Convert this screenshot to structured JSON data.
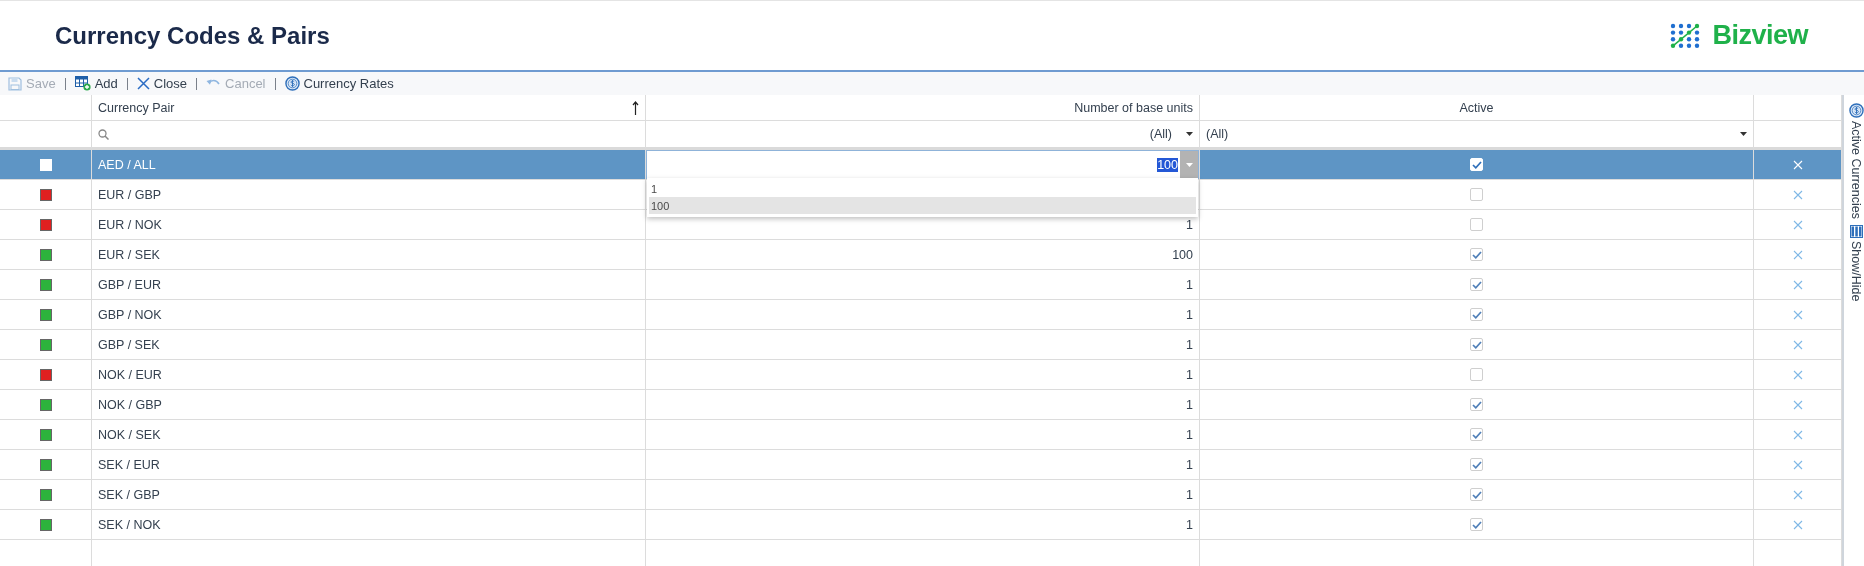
{
  "header": {
    "title": "Currency Codes & Pairs",
    "logo": "Bizview"
  },
  "toolbar": [
    {
      "label": "Save",
      "disabled": true
    },
    {
      "label": "Add",
      "disabled": false
    },
    {
      "label": "Close",
      "disabled": false
    },
    {
      "label": "Cancel",
      "disabled": true
    },
    {
      "label": "Currency Rates",
      "disabled": false
    }
  ],
  "columns": {
    "pair": "Currency Pair",
    "units": "Number of base units",
    "active": "Active"
  },
  "filters": {
    "units": "(All)",
    "active": "(All)"
  },
  "rows": [
    {
      "pair": "AED / ALL",
      "color": "#ffffff",
      "units": "100",
      "active": true,
      "selected": true,
      "editing": true
    },
    {
      "pair": "EUR / GBP",
      "color": "#e02020",
      "active": false,
      "selected": false,
      "editing": false
    },
    {
      "pair": "EUR / NOK",
      "color": "#e02020",
      "units": "1",
      "active": false,
      "selected": false,
      "editing": false
    },
    {
      "pair": "EUR / SEK",
      "color": "#2db33c",
      "units": "100",
      "active": true,
      "selected": false,
      "editing": false
    },
    {
      "pair": "GBP / EUR",
      "color": "#2db33c",
      "units": "1",
      "active": true,
      "selected": false,
      "editing": false
    },
    {
      "pair": "GBP / NOK",
      "color": "#2db33c",
      "units": "1",
      "active": true,
      "selected": false,
      "editing": false
    },
    {
      "pair": "GBP / SEK",
      "color": "#2db33c",
      "units": "1",
      "active": true,
      "selected": false,
      "editing": false
    },
    {
      "pair": "NOK / EUR",
      "color": "#e02020",
      "units": "1",
      "active": false,
      "selected": false,
      "editing": false
    },
    {
      "pair": "NOK / GBP",
      "color": "#2db33c",
      "units": "1",
      "active": true,
      "selected": false,
      "editing": false
    },
    {
      "pair": "NOK / SEK",
      "color": "#2db33c",
      "units": "1",
      "active": true,
      "selected": false,
      "editing": false
    },
    {
      "pair": "SEK / EUR",
      "color": "#2db33c",
      "units": "1",
      "active": true,
      "selected": false,
      "editing": false
    },
    {
      "pair": "SEK / GBP",
      "color": "#2db33c",
      "units": "1",
      "active": true,
      "selected": false,
      "editing": false
    },
    {
      "pair": "SEK / NOK",
      "color": "#2db33c",
      "units": "1",
      "active": true,
      "selected": false,
      "editing": false
    }
  ],
  "editor_options": [
    {
      "label": "1",
      "selected": false
    },
    {
      "label": "100",
      "selected": true
    }
  ],
  "side_panel": [
    {
      "label": "Active Currencies"
    },
    {
      "label": "Show/Hide"
    }
  ]
}
